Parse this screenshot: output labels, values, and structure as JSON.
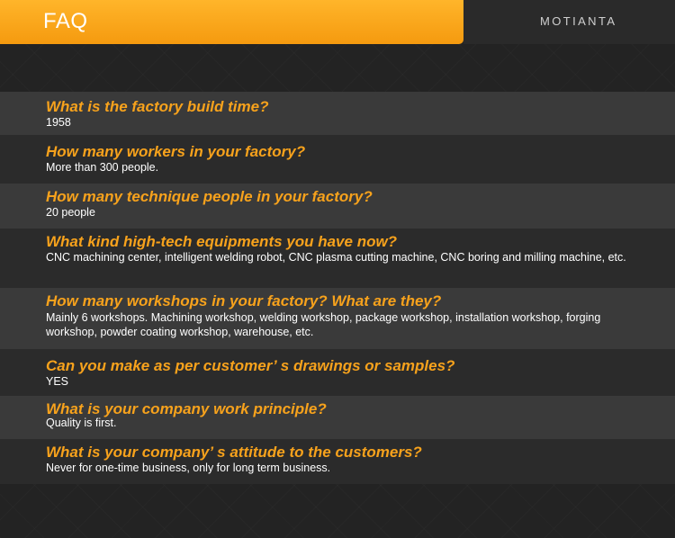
{
  "header": {
    "title": "FAQ",
    "brand": "MOTIANTA"
  },
  "faq": [
    {
      "question": "What is the factory build time?",
      "answer": "1958"
    },
    {
      "question": "How many workers in your factory?",
      "answer": " More than 300 people."
    },
    {
      "question": "How many technique people in your factory?",
      "answer": "20 people"
    },
    {
      "question": "What kind high-tech equipments you have now?",
      "answer": "CNC machining center, intelligent welding robot, CNC plasma cutting machine, CNC boring and milling machine, etc."
    },
    {
      "question": "How many workshops in your factory? What are they?",
      "answer": " Mainly 6 workshops. Machining workshop, welding workshop, package workshop, installation workshop, forging workshop, powder coating workshop, warehouse, etc."
    },
    {
      "question": "Can you make as per customer’ s drawings or samples?",
      "answer": "YES"
    },
    {
      "question": "What is your company work principle?",
      "answer": "Quality is first."
    },
    {
      "question": "What is your company’ s attitude to the customers?",
      "answer": "Never for one-time business, only for long term business."
    }
  ]
}
